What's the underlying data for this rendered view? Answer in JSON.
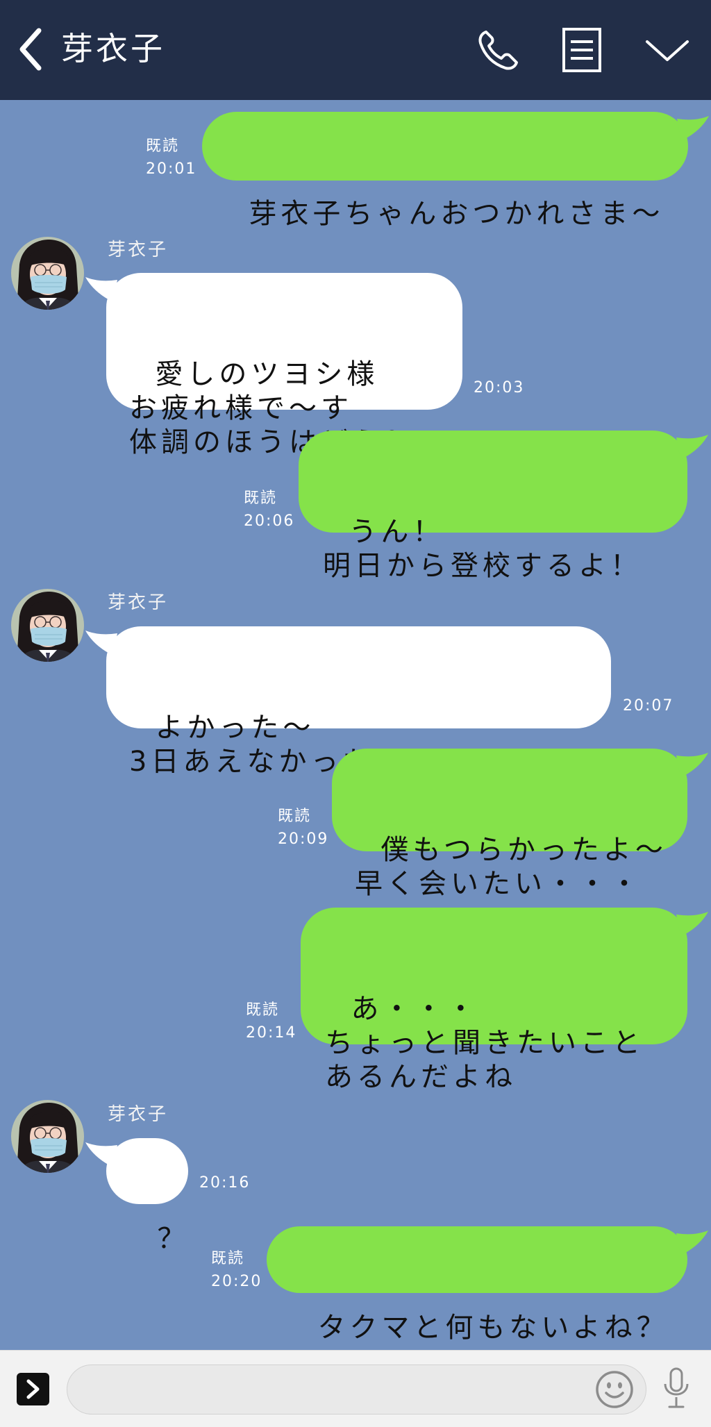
{
  "colors": {
    "header_bg": "#222e48",
    "chat_bg": "#7190bf",
    "sent_bubble": "#85e24a",
    "received_bubble": "#ffffff"
  },
  "header": {
    "title": "芽衣子",
    "icons": {
      "back": "chevron-left-icon",
      "call": "phone-icon",
      "notes": "list-icon",
      "menu": "chevron-down-icon"
    }
  },
  "messages": [
    {
      "text": "芽衣子ちゃんおつかれさま～",
      "read": "既読",
      "time": "20:01"
    },
    {
      "sender": "芽衣子",
      "text": "愛しのツヨシ様\nお疲れ様で～す\n体調のほうはどう？",
      "time": "20:03"
    },
    {
      "text": "うん！\n明日から登校するよ！",
      "read": "既読",
      "time": "20:06"
    },
    {
      "sender": "芽衣子",
      "text": "よかった～\n3日あえなかったのはつらたん",
      "time": "20:07"
    },
    {
      "text": "僕もつらかったよ～\n早く会いたい・・・",
      "read": "既読",
      "time": "20:09"
    },
    {
      "text": "あ・・・\nちょっと聞きたいこと\nあるんだよね",
      "read": "既読",
      "time": "20:14"
    },
    {
      "sender": "芽衣子",
      "text": "？",
      "time": "20:16"
    },
    {
      "text": "タクマと何もないよね？",
      "read": "既読",
      "time": "20:20"
    }
  ],
  "footer": {
    "input": {
      "value": "",
      "placeholder": ""
    },
    "icons": {
      "expand": "chevron-right-icon",
      "emoji": "smiley-icon",
      "voice": "microphone-icon"
    }
  }
}
